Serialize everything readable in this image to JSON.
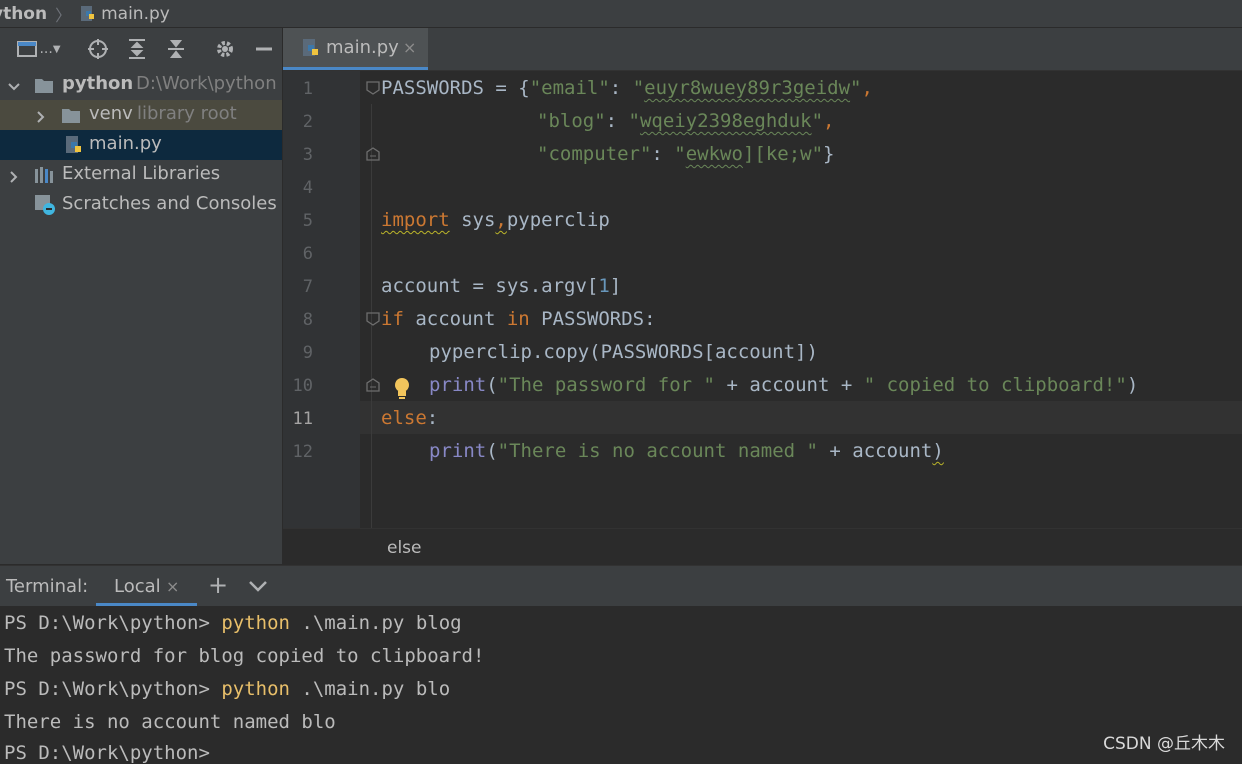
{
  "navbar": {
    "project": "ython",
    "file": "main.py"
  },
  "project_panel": {
    "toolbar": {
      "view_label": "..."
    },
    "tree": [
      {
        "label": "python",
        "hint": "D:\\Work\\python"
      },
      {
        "label": "venv",
        "hint": "library root"
      },
      {
        "label": "main.py",
        "hint": ""
      },
      {
        "label": "External Libraries",
        "hint": ""
      },
      {
        "label": "Scratches and Consoles",
        "hint": ""
      }
    ]
  },
  "editor": {
    "tab": {
      "label": "main.py",
      "close": "×"
    },
    "line_numbers": [
      "1",
      "2",
      "3",
      "4",
      "5",
      "6",
      "7",
      "8",
      "9",
      "10",
      "11",
      "12"
    ],
    "current_line": "11",
    "code": {
      "l1": {
        "a": "PASSWORDS = {",
        "k1": "\"email\"",
        "c1": ": ",
        "q1": "\"",
        "v1": "euyr8wuey89r3geidw",
        "q2": "\"",
        "e": ","
      },
      "l2": {
        "k": "\"blog\"",
        "c": ": ",
        "q1": "\"",
        "v": "wqeiy2398eghduk",
        "q2": "\"",
        "e": ","
      },
      "l3": {
        "k": "\"computer\"",
        "c": ": ",
        "q1": "\"",
        "v": "ewkwo",
        "v2": "][ke;w\"",
        "e": "}"
      },
      "l5": {
        "kw": "import",
        "rest1": " sys",
        "comma": ",",
        "rest2": "pyperclip"
      },
      "l7": {
        "a": "account = sys.argv[",
        "n": "1",
        "b": "]"
      },
      "l8": {
        "kw1": "if",
        "a": " account ",
        "kw2": "in",
        "b": " PASSWORDS:"
      },
      "l9": {
        "a": "pyperclip.copy(PASSWORDS[account])"
      },
      "l10": {
        "f": "print",
        "a": "(",
        "s1": "\"The password for \"",
        "b": " + account + ",
        "s2": "\" copied to clipboard!\"",
        "c": ")"
      },
      "l11": {
        "kw": "else",
        "a": ":"
      },
      "l12": {
        "f": "print",
        "a": "(",
        "s": "\"There is no account named \"",
        "b": " + account",
        "c": ")"
      }
    },
    "breadcrumb": "else"
  },
  "terminal": {
    "title": "Terminal:",
    "tab": {
      "label": "Local",
      "close": "×"
    },
    "add": "+",
    "lines": [
      {
        "prompt": "PS D:\\Work\\python> ",
        "cmd": "python",
        "args": " .\\main.py blog"
      },
      {
        "text": "The password for blog copied to clipboard!"
      },
      {
        "prompt": "PS D:\\Work\\python> ",
        "cmd": "python",
        "args": " .\\main.py blo"
      },
      {
        "text": "There is no account named blo"
      },
      {
        "prompt": "PS D:\\Work\\python>"
      }
    ]
  },
  "watermark": "CSDN @丘木木",
  "colors": {
    "keyword": "#cc7832",
    "string": "#6a8759",
    "number": "#6897bb",
    "builtin": "#8888c6",
    "accent": "#4a88c7"
  }
}
